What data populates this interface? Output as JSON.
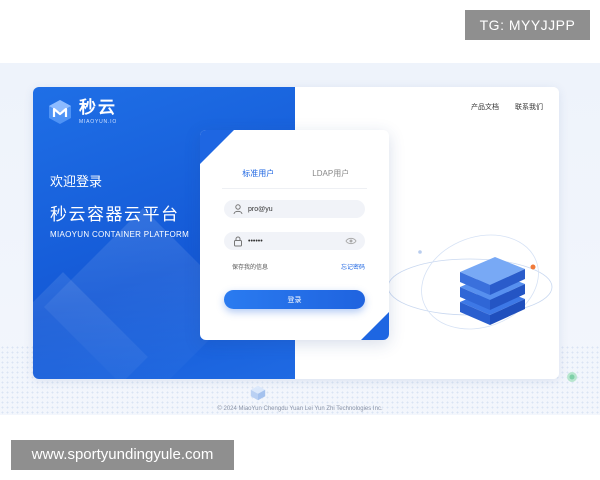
{
  "overlay": {
    "tg_label": "TG: MYYJJPP",
    "site_label": "www.sportyundingyule.com"
  },
  "brand": {
    "name": "秒云",
    "subname": "MIAOYUN.IO",
    "logo_icon": "miaoyun-logo-icon",
    "accent": "#1e66e2"
  },
  "left_panel": {
    "welcome": "欢迎登录",
    "title": "秒云容器云平台",
    "subtitle": "MIAOYUN CONTAINER PLATFORM"
  },
  "top_links": {
    "docs": "产品文档",
    "contact": "联系我们"
  },
  "login": {
    "tabs": [
      {
        "label": "标准用户",
        "active": true
      },
      {
        "label": "LDAP用户",
        "active": false
      }
    ],
    "username": {
      "value": "pro@yu",
      "icon": "user-icon"
    },
    "password": {
      "value": "••••••",
      "icon": "lock-icon",
      "toggle_icon": "eye-icon"
    },
    "remember_label": "保存我的信息",
    "forgot_label": "忘记密码",
    "submit_label": "登录"
  },
  "footer": {
    "copyright": "© 2024 MiaoYun Chengdu Yuan Lei Yun Zhi Technologies Inc."
  }
}
